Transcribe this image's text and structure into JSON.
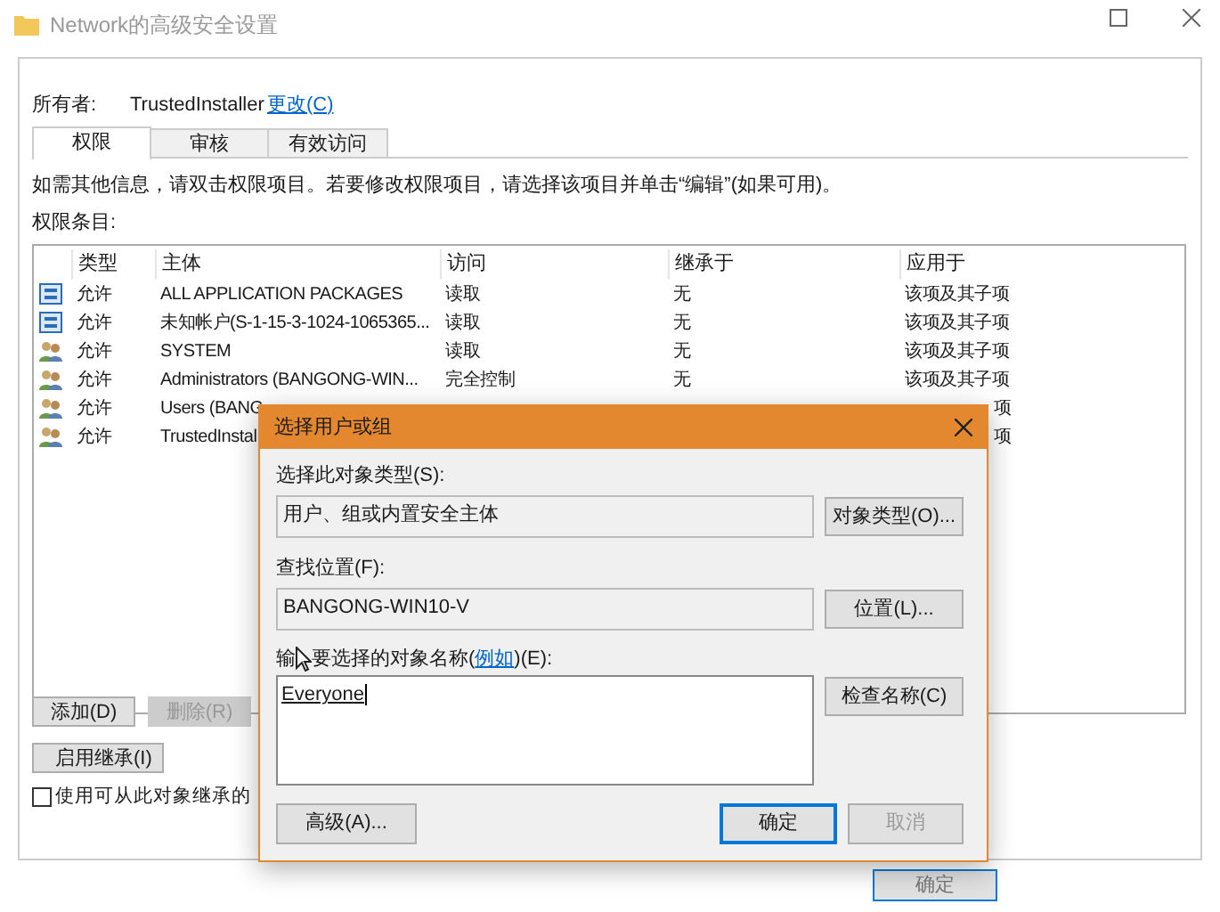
{
  "window": {
    "title": "Network的高级安全设置"
  },
  "owner": {
    "label": "所有者:",
    "value": "TrustedInstaller",
    "change_link": "更改(C)"
  },
  "tabs": [
    {
      "label": "权限",
      "selected": true
    },
    {
      "label": "审核",
      "selected": false
    },
    {
      "label": "有效访问",
      "selected": false
    }
  ],
  "info": "如需其他信息，请双击权限项目。若要修改权限项目，请选择该项目并单击“编辑”(如果可用)。",
  "entries_label": "权限条目:",
  "table": {
    "columns": [
      "类型",
      "主体",
      "访问",
      "继承于",
      "应用于"
    ],
    "rows": [
      {
        "kind": "package",
        "cells": [
          "允许",
          "ALL APPLICATION PACKAGES",
          "读取",
          "无",
          "该项及其子项"
        ]
      },
      {
        "kind": "package",
        "cells": [
          "允许",
          "未知帐户(S-1-15-3-1024-1065365...",
          "读取",
          "无",
          "该项及其子项"
        ]
      },
      {
        "kind": "users",
        "cells": [
          "允许",
          "SYSTEM",
          "读取",
          "无",
          "该项及其子项"
        ]
      },
      {
        "kind": "users",
        "cells": [
          "允许",
          "Administrators (BANGONG-WIN...",
          "完全控制",
          "无",
          "该项及其子项"
        ]
      },
      {
        "kind": "users",
        "cells": [
          "允许",
          "Users (BANG",
          "",
          "",
          "项"
        ]
      },
      {
        "kind": "users",
        "cells": [
          "允许",
          "TrustedInstal",
          "",
          "",
          "项"
        ]
      }
    ]
  },
  "buttons": [
    {
      "label": "添加(D)",
      "disabled": false
    },
    {
      "label": "删除(R)",
      "disabled": true
    }
  ],
  "inherit_button": "启用继承(I)",
  "replace_checkbox": {
    "label": "使用可从此对象继承的",
    "checked": false
  },
  "ok_button": "确定",
  "dialog": {
    "title": "选择用户或组",
    "type_label": "选择此对象类型(S):",
    "type_value": "用户、组或内置安全主体",
    "type_button": "对象类型(O)...",
    "location_label": "查找位置(F):",
    "location_value": "BANGONG-WIN10-V",
    "location_button": "位置(L)...",
    "name_label_prefix": "输",
    "name_label": "要选择的对象名称(",
    "name_link": "例如",
    "name_label_suffix": ")(E):",
    "name_value": "Everyone",
    "check_button": "检查名称(C)",
    "advanced_button": "高级(A)...",
    "ok_button": "确定",
    "cancel_button": "取消"
  }
}
